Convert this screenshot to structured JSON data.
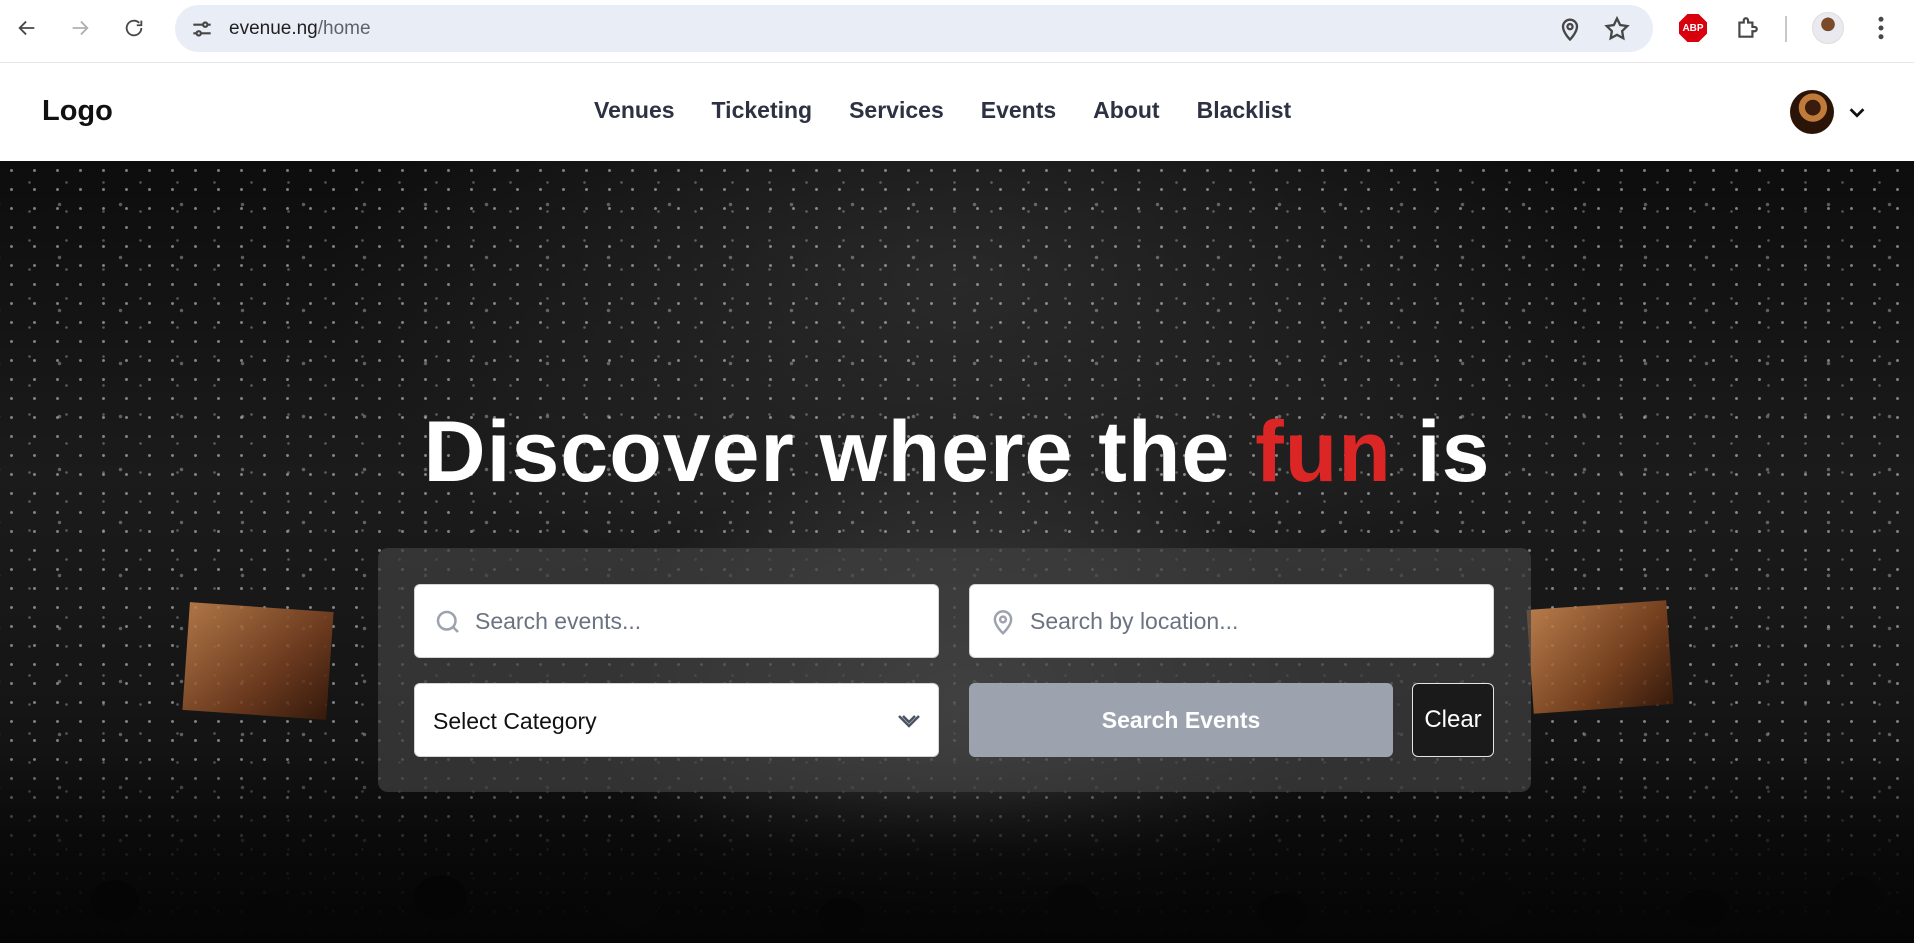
{
  "browser": {
    "url_domain": "evenue.ng",
    "url_path": "/home",
    "extension_badge": "ABP"
  },
  "site": {
    "logo": "Logo",
    "nav": [
      "Venues",
      "Ticketing",
      "Services",
      "Events",
      "About",
      "Blacklist"
    ]
  },
  "hero": {
    "headline_pre": "Discover where the ",
    "headline_accent": "fun",
    "headline_post": " is",
    "accent_color": "#dc2626"
  },
  "search": {
    "events_placeholder": "Search events...",
    "location_placeholder": "Search by location...",
    "category_label": "Select Category",
    "search_button": "Search Events",
    "clear_button": "Clear"
  },
  "icons": [
    "back-icon",
    "forward-icon",
    "reload-icon",
    "site-info-icon",
    "location-icon",
    "star-icon",
    "abp-icon",
    "extensions-icon",
    "profile-icon",
    "menu-icon",
    "search-icon",
    "map-pin-icon",
    "chevron-down-icon"
  ]
}
